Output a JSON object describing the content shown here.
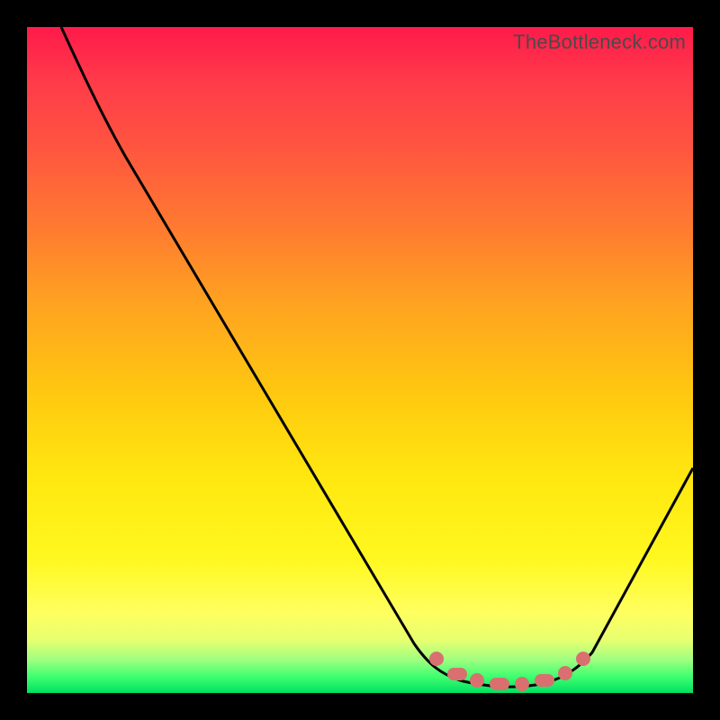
{
  "watermark": "TheBottleneck.com",
  "colors": {
    "gradient_top": "#ff1a4a",
    "gradient_bottom": "#00e060",
    "curve": "#000000",
    "dot": "#d9706f",
    "frame_bg": "#000000"
  },
  "chart_data": {
    "type": "line",
    "title": "",
    "xlabel": "",
    "ylabel": "",
    "xlim": [
      0,
      100
    ],
    "ylim": [
      0,
      100
    ],
    "grid": false,
    "note": "No numeric axis ticks are shown; x/y are normalized 0–100 from the plot area. y=100 is top (worst/red), y=0 is bottom (best/green). Curve values estimated from pixel positions.",
    "series": [
      {
        "name": "bottleneck-curve",
        "x": [
          5,
          10,
          15,
          20,
          25,
          30,
          35,
          40,
          45,
          50,
          55,
          60,
          63,
          66,
          70,
          74,
          78,
          82,
          86,
          90,
          95,
          100
        ],
        "y": [
          100,
          93,
          85,
          77,
          68,
          59,
          50,
          42,
          33,
          25,
          17,
          10,
          6,
          4,
          2,
          1,
          1,
          2,
          5,
          10,
          20,
          35
        ]
      }
    ],
    "markers": {
      "name": "optimal-range-dots",
      "x": [
        63,
        66,
        69,
        72,
        75,
        78,
        81,
        84
      ],
      "y": [
        4.5,
        3.2,
        2.3,
        1.7,
        1.5,
        1.7,
        2.5,
        4.2
      ]
    }
  }
}
